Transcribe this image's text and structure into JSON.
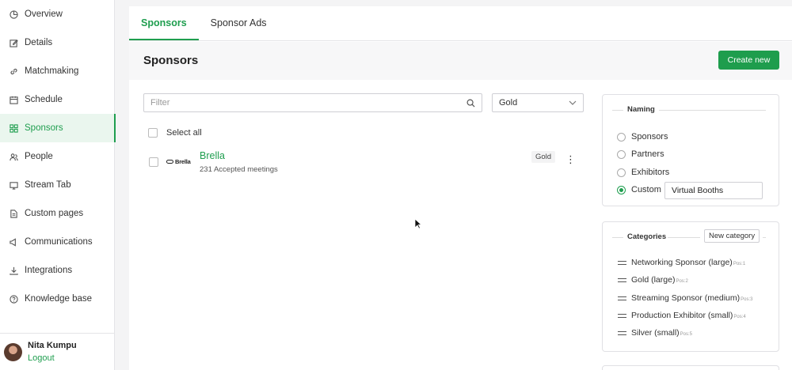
{
  "sidebar": {
    "items": [
      {
        "label": "Overview",
        "icon": "pie-chart-icon"
      },
      {
        "label": "Details",
        "icon": "edit-icon"
      },
      {
        "label": "Matchmaking",
        "icon": "link-icon"
      },
      {
        "label": "Schedule",
        "icon": "calendar-icon"
      },
      {
        "label": "Sponsors",
        "icon": "grid-icon",
        "active": true
      },
      {
        "label": "People",
        "icon": "people-icon"
      },
      {
        "label": "Stream Tab",
        "icon": "monitor-icon"
      },
      {
        "label": "Custom pages",
        "icon": "document-icon"
      },
      {
        "label": "Communications",
        "icon": "megaphone-icon"
      },
      {
        "label": "Integrations",
        "icon": "download-icon"
      },
      {
        "label": "Knowledge base",
        "icon": "help-icon"
      }
    ],
    "user": {
      "name": "Nita Kumpu",
      "logout_label": "Logout"
    }
  },
  "tabs": [
    {
      "label": "Sponsors",
      "active": true
    },
    {
      "label": "Sponsor Ads",
      "active": false
    }
  ],
  "header": {
    "title": "Sponsors",
    "create_label": "Create new"
  },
  "filter": {
    "placeholder": "Filter",
    "value": ""
  },
  "level_select": {
    "value": "Gold"
  },
  "select_all_label": "Select all",
  "sponsors": [
    {
      "logo_text": "Brella",
      "name": "Brella",
      "meta": "231 Accepted meetings",
      "tag": "Gold"
    }
  ],
  "naming": {
    "title": "Naming",
    "options": [
      "Sponsors",
      "Partners",
      "Exhibitors",
      "Custom"
    ],
    "selected": "Custom",
    "custom_value": "Virtual Booths"
  },
  "categories": {
    "title": "Categories",
    "new_label": "New category",
    "items": [
      {
        "name": "Networking Sponsor (large)",
        "pos": "Pos:1"
      },
      {
        "name": "Gold (large)",
        "pos": "Pos:2"
      },
      {
        "name": "Streaming Sponsor (medium)",
        "pos": "Pos:3"
      },
      {
        "name": "Production Exhibitor (small)",
        "pos": "Pos:4"
      },
      {
        "name": "Silver (small)",
        "pos": "Pos:5"
      }
    ]
  },
  "colors": {
    "accent": "#1f9e4f",
    "button": "#1e9d4d"
  }
}
